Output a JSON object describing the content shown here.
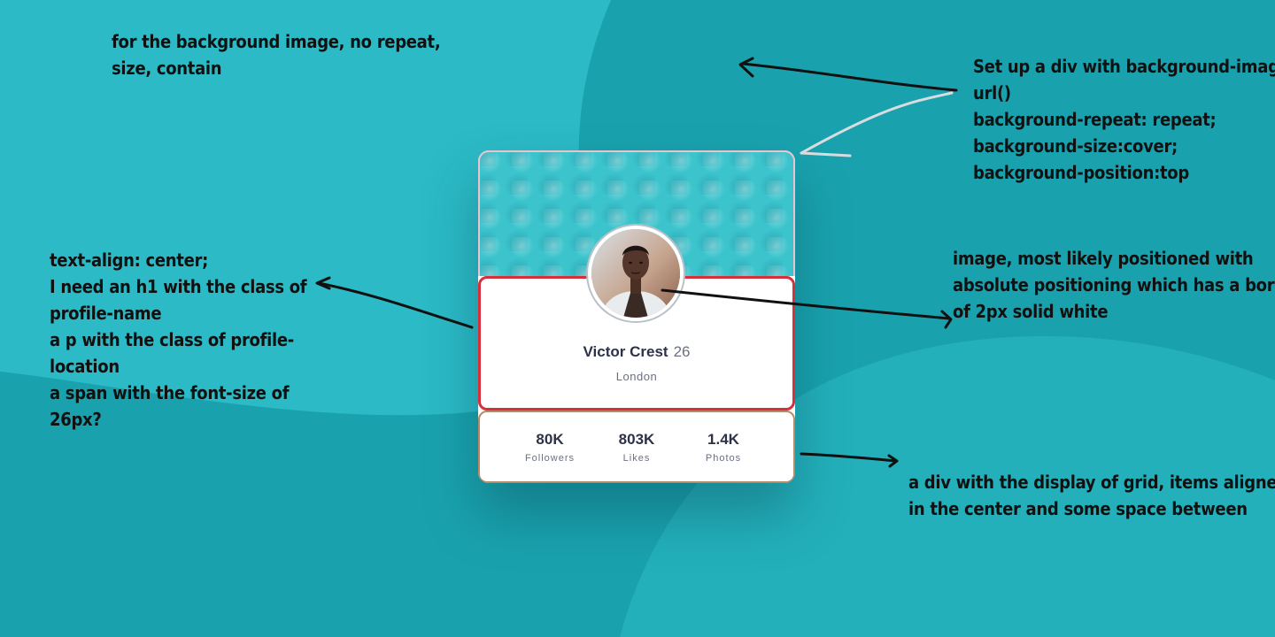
{
  "notes": {
    "background": [
      "for the background image, no repeat,",
      "size, contain"
    ],
    "header_div": [
      "Set up a div with background-image:",
      "url()",
      "background-repeat: repeat;",
      "background-size:cover;",
      "background-position:top"
    ],
    "text_block": [
      "text-align: center;",
      "I need an h1 with the class of",
      "profile-name",
      "a p with the class of profile-",
      "location",
      "a span with the font-size of",
      "26px?"
    ],
    "image": [
      "image, most likely positioned with",
      "absolute positioning which has a border",
      "of 2px solid white"
    ],
    "stats": [
      "a div with the display of grid, items aligned",
      "in the center and some space between"
    ]
  },
  "profile": {
    "name": "Victor Crest",
    "age": "26",
    "location": "London"
  },
  "stats": [
    {
      "value": "80K",
      "label": "Followers"
    },
    {
      "value": "803K",
      "label": "Likes"
    },
    {
      "value": "1.4K",
      "label": "Photos"
    }
  ],
  "colors": {
    "background": "#19a2ae",
    "text_dark": "#2e3249",
    "text_muted": "#6b7082",
    "info_border": "#d6303a",
    "stats_border": "#b98a66"
  }
}
